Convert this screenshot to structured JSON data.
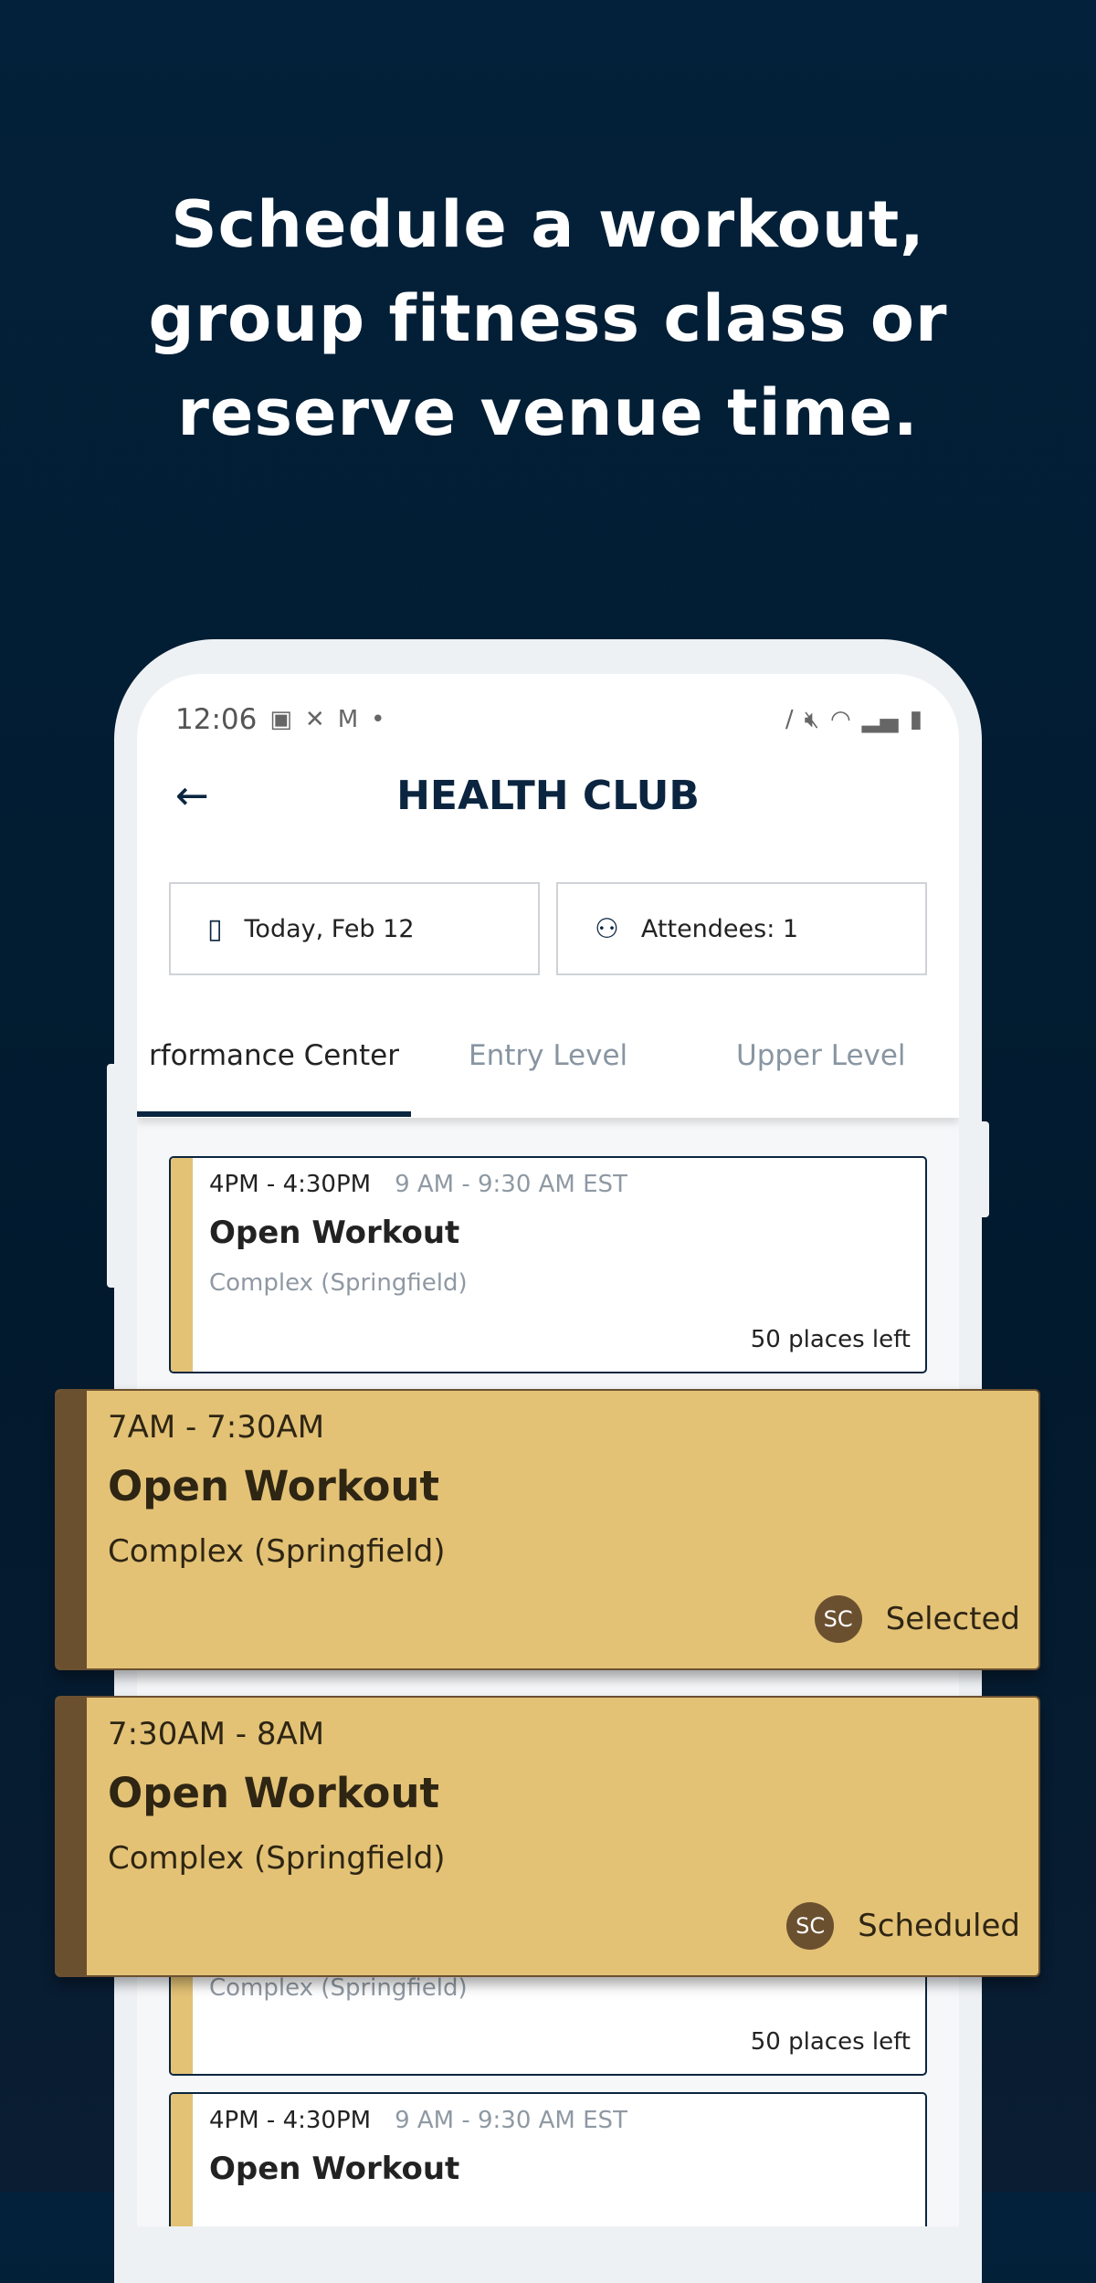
{
  "headline": [
    "Schedule a workout,",
    "group fitness class or",
    "reserve venue time."
  ],
  "status_bar": {
    "time": "12:06"
  },
  "header": {
    "title": "HEALTH CLUB",
    "back_icon": "arrow-left-icon"
  },
  "filters": {
    "date": "Today, Feb 12",
    "attendees": "Attendees: 1"
  },
  "tabs": [
    {
      "label": "rformance Center",
      "active": true
    },
    {
      "label": "Entry Level"
    },
    {
      "label": "Upper Level"
    }
  ],
  "cards": [
    {
      "time": "4PM - 4:30PM",
      "local_time": "9 AM - 9:30 AM EST",
      "name": "Open Workout",
      "location": "Complex (Springfield)",
      "places": "50 places left"
    },
    {
      "location": "Complex (Springfield)",
      "places": "50 places left"
    },
    {
      "time": "4PM - 4:30PM",
      "local_time": "9 AM - 9:30 AM EST",
      "name": "Open Workout"
    }
  ],
  "overlays": [
    {
      "time": "7AM - 7:30AM",
      "name": "Open Workout",
      "location": "Complex (Springfield)",
      "initials": "SC",
      "status": "Selected"
    },
    {
      "time": "7:30AM - 8AM",
      "name": "Open Workout",
      "location": "Complex (Springfield)",
      "initials": "SC",
      "status": "Scheduled"
    }
  ],
  "colors": {
    "background": "#03213a",
    "accent": "#e3c276",
    "accent_dark": "#6b5030",
    "navy": "#0b2540"
  }
}
